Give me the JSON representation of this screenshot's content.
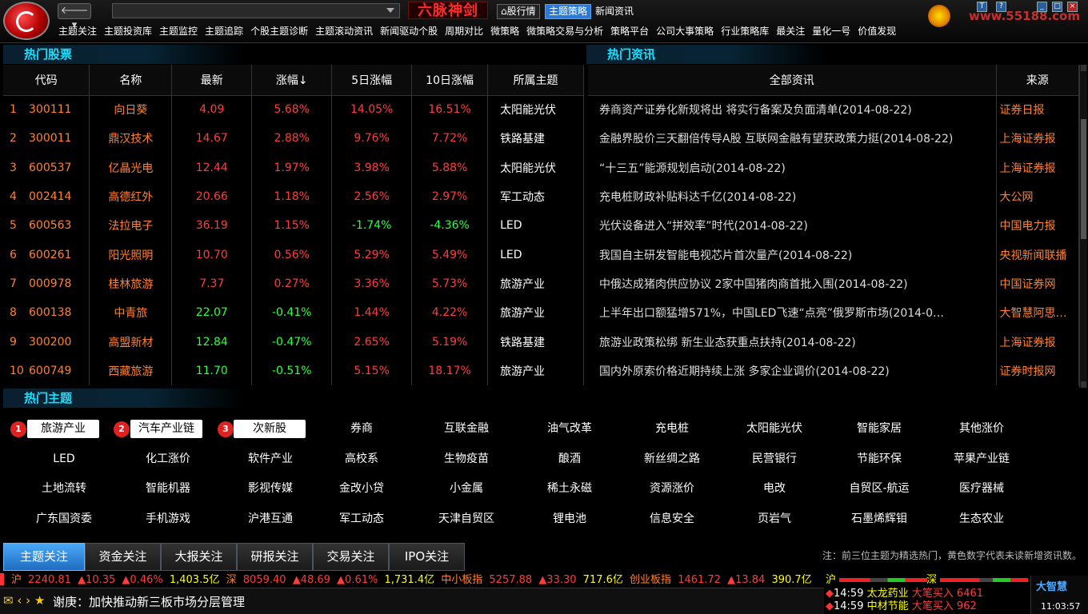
{
  "app": {
    "brand": "六脉神剑",
    "site": "www.55188.com"
  },
  "top_tabs": [
    "股行情",
    "主题策略",
    "新闻资讯"
  ],
  "menu": [
    "主题关注",
    "主题投资库",
    "主题监控",
    "主题追踪",
    "个股主题诊断",
    "主题滚动资讯",
    "新闻驱动个股",
    "周期对比",
    "微策略",
    "微策略交易与分析",
    "策略平台",
    "公司大事策略",
    "行业策略库",
    "最关注",
    "量化一号",
    "价值发现"
  ],
  "hot_stocks": {
    "title": "热门股票",
    "headers": [
      "代码",
      "名称",
      "最新",
      "涨幅↓",
      "5日涨幅",
      "10日涨幅",
      "所属主题"
    ],
    "rows": [
      {
        "no": "1",
        "code": "300111",
        "name": "向日葵",
        "last": "4.09",
        "chg": "5.68%",
        "d5": "14.05%",
        "d10": "16.51%",
        "theme": "太阳能光伏"
      },
      {
        "no": "2",
        "code": "300011",
        "name": "鼎汉技术",
        "last": "14.67",
        "chg": "2.88%",
        "d5": "9.76%",
        "d10": "7.72%",
        "theme": "铁路基建"
      },
      {
        "no": "3",
        "code": "600537",
        "name": "亿晶光电",
        "last": "12.44",
        "chg": "1.97%",
        "d5": "3.98%",
        "d10": "5.88%",
        "theme": "太阳能光伏"
      },
      {
        "no": "4",
        "code": "002414",
        "name": "高德红外",
        "last": "20.66",
        "chg": "1.18%",
        "d5": "2.56%",
        "d10": "2.97%",
        "theme": "军工动态"
      },
      {
        "no": "5",
        "code": "600563",
        "name": "法拉电子",
        "last": "36.19",
        "chg": "1.15%",
        "d5": "-1.74%",
        "d10": "-4.36%",
        "theme": "LED"
      },
      {
        "no": "6",
        "code": "600261",
        "name": "阳光照明",
        "last": "10.70",
        "chg": "0.56%",
        "d5": "5.29%",
        "d10": "5.49%",
        "theme": "LED"
      },
      {
        "no": "7",
        "code": "000978",
        "name": "桂林旅游",
        "last": "7.37",
        "chg": "0.27%",
        "d5": "3.36%",
        "d10": "5.73%",
        "theme": "旅游产业"
      },
      {
        "no": "8",
        "code": "600138",
        "name": "中青旅",
        "last": "22.07",
        "chg": "-0.41%",
        "d5": "1.44%",
        "d10": "4.22%",
        "theme": "旅游产业"
      },
      {
        "no": "9",
        "code": "300200",
        "name": "高盟新材",
        "last": "12.84",
        "chg": "-0.47%",
        "d5": "2.65%",
        "d10": "5.19%",
        "theme": "铁路基建"
      },
      {
        "no": "10",
        "code": "600749",
        "name": "西藏旅游",
        "last": "11.70",
        "chg": "-0.51%",
        "d5": "5.15%",
        "d10": "18.17%",
        "theme": "旅游产业"
      }
    ]
  },
  "hot_news": {
    "title": "热门资讯",
    "headers": [
      "全部资讯",
      "来源"
    ],
    "rows": [
      {
        "text": "券商资产证券化新规将出 将实行备案及负面清单(2014-08-22)",
        "src": "证券日报"
      },
      {
        "text": "金融界股价三天翻倍传导A股 互联网金融有望获政策力挺(2014-08-22)",
        "src": "上海证券报"
      },
      {
        "text": "“十三五”能源规划启动(2014-08-22)",
        "src": "上海证券报"
      },
      {
        "text": "充电桩财政补贴料达千亿(2014-08-22)",
        "src": "大公网"
      },
      {
        "text": "光伏设备进入“拼效率”时代(2014-08-22)",
        "src": "中国电力报"
      },
      {
        "text": "我国自主研发智能电视芯片首次量产(2014-08-22)",
        "src": "央视新闻联播"
      },
      {
        "text": "中俄达成猪肉供应协议 2家中国猪肉商首批入围(2014-08-22)",
        "src": "中国证券网"
      },
      {
        "text": "上半年出口额猛增571%，中国LED飞速“点亮”俄罗斯市场(2014-0…",
        "src": "大智慧阿思…"
      },
      {
        "text": "旅游业政策松绑 新生业态获重点扶持(2014-08-22)",
        "src": "上海证券报"
      },
      {
        "text": "国内外原索价格近期持续上涨 多家企业调价(2014-08-22)",
        "src": "证券时报网"
      }
    ]
  },
  "hot_themes": {
    "title": "热门主题",
    "top3": [
      "旅游产业",
      "汽车产业链",
      "次新股"
    ],
    "row1": [
      "券商",
      "互联金融",
      "油气改革",
      "充电桩",
      "太阳能光伏",
      "智能家居",
      "其他涨价"
    ],
    "row2": [
      "LED",
      "化工涨价",
      "软件产业",
      "高校系",
      "生物疫苗",
      "酿酒",
      "新丝绸之路",
      "民营银行",
      "节能环保",
      "苹果产业链"
    ],
    "row3": [
      "土地流转",
      "智能机器",
      "影视传媒",
      "金改小贷",
      "小金属",
      "稀土永磁",
      "资源涨价",
      "电改",
      "自贸区-航运",
      "医疗器械"
    ],
    "row4": [
      "广东国资委",
      "手机游戏",
      "沪港互通",
      "军工动态",
      "天津自贸区",
      "锂电池",
      "信息安全",
      "页岩气",
      "石墨烯辉钼",
      "生态农业"
    ]
  },
  "bottom_tabs": [
    "主题关注",
    "资金关注",
    "大报关注",
    "研报关注",
    "交易关注",
    "IPO关注"
  ],
  "note": "注：前三位主题为精选热门，黄色数字代表未读新增资讯数。",
  "ticker": {
    "sh": {
      "name": "沪",
      "index": "2240.81",
      "chg": "▲10.35",
      "pct": "▲0.46%",
      "amt": "1,403.5亿"
    },
    "sz": {
      "name": "深",
      "index": "8059.40",
      "chg": "▲48.69",
      "pct": "▲0.61%",
      "amt": "1,731.4亿"
    },
    "zx": {
      "name": "中小板指",
      "index": "5257.88",
      "chg": "▲33.30",
      "amt": "717.6亿"
    },
    "cy": {
      "name": "创业板指",
      "index": "1461.72",
      "chg": "▲13.84",
      "amt": "390.7亿"
    },
    "sh2": "沪",
    "sz2": "深"
  },
  "status_msg": "谢庚：加快推动新三板市场分层管理",
  "alerts": [
    {
      "time": "14:59",
      "name": "太龙药业",
      "action": "大笔买入",
      "vol": "6461"
    },
    {
      "time": "14:59",
      "name": "中材节能",
      "action": "大笔买入",
      "vol": "962"
    }
  ],
  "clock": {
    "logo": "大智慧",
    "time": "11:03:57"
  }
}
